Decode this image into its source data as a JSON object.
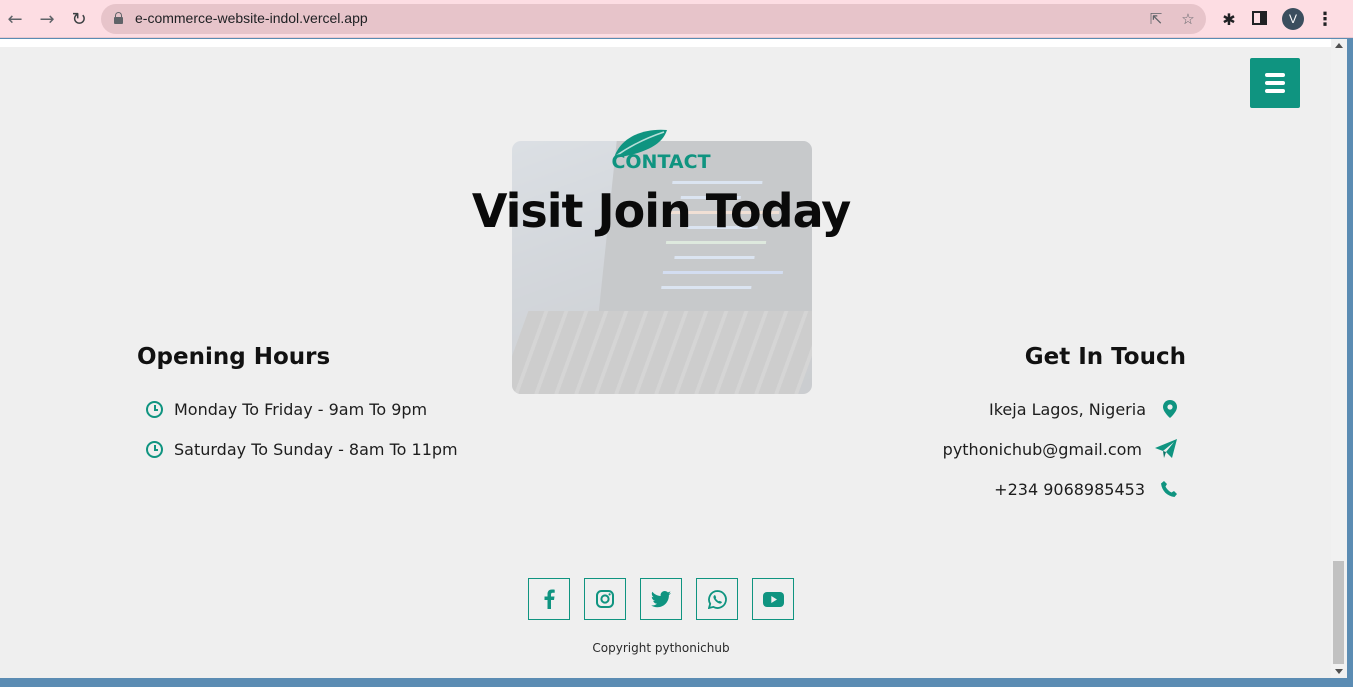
{
  "browser": {
    "url": "e-commerce-website-indol.vercel.app",
    "avatar_letter": "V"
  },
  "colors": {
    "accent": "#0f9480",
    "page_bg": "#efefef",
    "chrome_bg": "#fddde3",
    "omnibox_bg": "#e7c4ca"
  },
  "contact": {
    "label": "CONTACT",
    "title": "Visit Join Today"
  },
  "opening_hours": {
    "title": "Opening Hours",
    "rows": [
      {
        "icon": "clock-icon",
        "text": "Monday To Friday - 9am To 9pm"
      },
      {
        "icon": "clock-icon",
        "text": "Saturday To Sunday - 8am To 11pm"
      }
    ]
  },
  "get_in_touch": {
    "title": "Get In Touch",
    "rows": [
      {
        "icon": "map-marker-icon",
        "text": "Ikeja Lagos, Nigeria"
      },
      {
        "icon": "paper-plane-icon",
        "text": "pythonichub@gmail.com"
      },
      {
        "icon": "phone-icon",
        "text": "+234 9068985453"
      }
    ]
  },
  "socials": [
    "facebook-icon",
    "instagram-icon",
    "twitter-icon",
    "whatsapp-icon",
    "youtube-icon"
  ],
  "footer": {
    "copyright": "Copyright pythonichub"
  }
}
